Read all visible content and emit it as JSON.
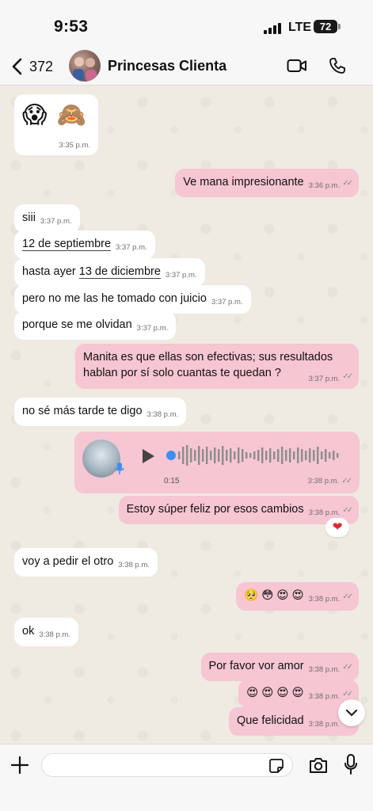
{
  "status_bar": {
    "time": "9:53",
    "network": "LTE",
    "battery": "72"
  },
  "header": {
    "back_count": "372",
    "contact_name": "Princesas Clienta",
    "icons": {
      "back": "chevron-left-icon",
      "video": "video-camera-icon",
      "phone": "phone-icon"
    }
  },
  "messages": [
    {
      "dir": "in",
      "text": "😱 🙈",
      "time": "3:35 p.m."
    },
    {
      "dir": "out",
      "text": "Ve mana impresionante",
      "time": "3:36 p.m."
    },
    {
      "dir": "in",
      "text": "siii",
      "time": "3:37 p.m."
    },
    {
      "dir": "in",
      "text": "12 de septiembre",
      "time": "3:37 p.m."
    },
    {
      "dir": "in",
      "text_prefix": "hasta ayer ",
      "text_link": "13 de diciembre",
      "time": "3:37 p.m."
    },
    {
      "dir": "in",
      "text": "pero no me las he tomado con juicio",
      "time": "3:37 p.m."
    },
    {
      "dir": "in",
      "text": "porque se me olvidan",
      "time": "3:37 p.m."
    },
    {
      "dir": "out",
      "line1": "Manita es que ellas son efectivas; sus resultados",
      "line2": "hablan por sí solo cuantas te quedan ?",
      "time": "3:37 p.m."
    },
    {
      "dir": "in",
      "text": "no sé más tarde te digo",
      "time": "3:38 p.m."
    },
    {
      "dir": "out",
      "type": "voice",
      "duration": "0:15",
      "time": "3:38 p.m."
    },
    {
      "dir": "out",
      "text": "Estoy súper feliz por esos cambios",
      "time": "3:38 p.m.",
      "reaction": "❤"
    },
    {
      "dir": "in",
      "text": "voy a pedir el otro",
      "time": "3:38 p.m."
    },
    {
      "dir": "out",
      "text": "🥺 😳 😍 😍",
      "time": "3:38 p.m."
    },
    {
      "dir": "in",
      "text": "ok",
      "time": "3:38 p.m."
    },
    {
      "dir": "out",
      "text": "Por favor vor amor",
      "time": "3:38 p.m."
    },
    {
      "dir": "out",
      "text": "😍 😍 😍 😍",
      "time": "3:38 p.m."
    },
    {
      "dir": "out",
      "text": "Que felicidad",
      "time": "3:38 p.m."
    }
  ],
  "composer": {
    "placeholder": ""
  },
  "colors": {
    "outgoing": "#f6c6d2",
    "incoming": "#ffffff",
    "background": "#efeae2",
    "read_ticks": "#8a8a8a"
  }
}
